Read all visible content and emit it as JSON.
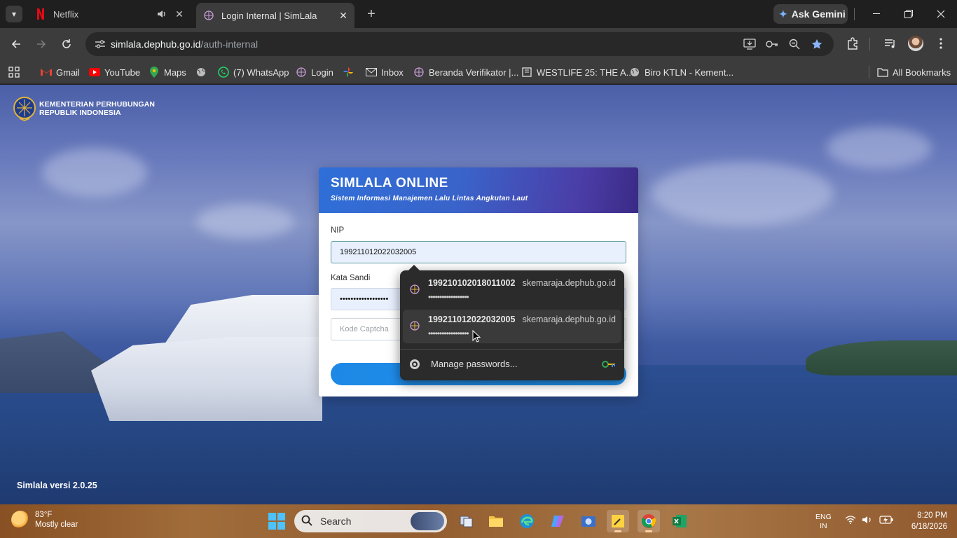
{
  "browser": {
    "tabs": [
      {
        "title": "Netflix",
        "favicon": "netflix-icon",
        "audio": true
      },
      {
        "title": "Login Internal | SimLala",
        "favicon": "simlala-globe-icon",
        "active": true
      }
    ],
    "gemini_label": "Ask Gemini",
    "url_host": "simlala.dephub.go.id",
    "url_path": "/auth-internal",
    "bookmarks": [
      {
        "label": "Gmail",
        "icon": "gmail-icon"
      },
      {
        "label": "YouTube",
        "icon": "youtube-icon"
      },
      {
        "label": "Maps",
        "icon": "maps-icon"
      },
      {
        "label": "",
        "icon": "globe-icon"
      },
      {
        "label": "(7) WhatsApp",
        "icon": "whatsapp-icon"
      },
      {
        "label": "Login",
        "icon": "simlala-globe-icon"
      },
      {
        "label": "",
        "icon": "pinwheel-icon"
      },
      {
        "label": "Inbox",
        "icon": "mail-icon"
      },
      {
        "label": "Beranda Verifikator |...",
        "icon": "simlala-globe-icon"
      },
      {
        "label": "WESTLIFE 25: THE A...",
        "icon": "bookmark-page-icon"
      },
      {
        "label": "Biro KTLN - Kement...",
        "icon": "globe-icon"
      }
    ],
    "all_bookmarks": "All Bookmarks"
  },
  "page": {
    "org_line1": "KEMENTERIAN PERHUBUNGAN",
    "org_line2": "REPUBLIK INDONESIA",
    "card_title": "SIMLALA ONLINE",
    "card_subtitle": "Sistem Informasi Manajemen Lalu Lintas Angkutan Laut",
    "nip_label": "NIP",
    "nip_value": "199211012022032005",
    "password_label": "Kata Sandi",
    "password_value": "••••••••••••••••••",
    "captcha_placeholder": "Kode Captcha",
    "version": "Simlala versi 2.0.25"
  },
  "autofill": {
    "items": [
      {
        "username": "199210102018011002",
        "site": "skemaraja.dephub.go.id",
        "password": "••••••••••••••••••"
      },
      {
        "username": "199211012022032005",
        "site": "skemaraja.dephub.go.id",
        "password": "••••••••••••••••••"
      }
    ],
    "manage_label": "Manage passwords..."
  },
  "taskbar": {
    "temperature": "83°F",
    "weather": "Mostly clear",
    "search_label": "Search",
    "lang_line1": "ENG",
    "lang_line2": "IN",
    "time": "8:20 PM",
    "date": "6/18/2026"
  }
}
